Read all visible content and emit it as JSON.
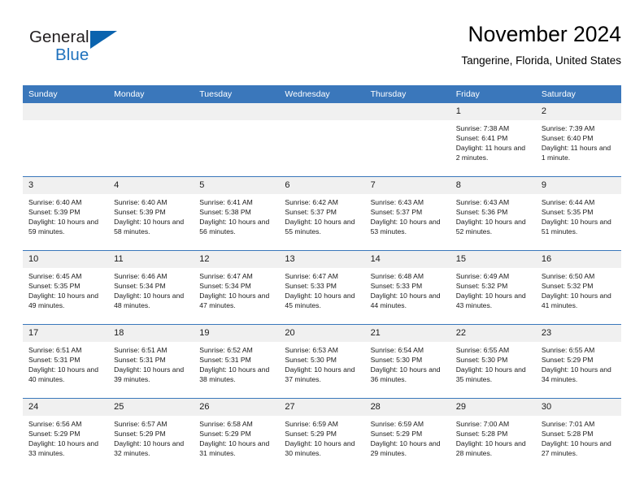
{
  "brand": {
    "name_top": "General",
    "name_bottom": "Blue",
    "color_dark": "#231f20",
    "color_blue": "#1f72bd",
    "triangle_color": "#0a63ae"
  },
  "header": {
    "title": "November 2024",
    "subtitle": "Tangerine, Florida, United States"
  },
  "theme": {
    "header_bar": "#3a77bb",
    "daynum_bg": "#f0f0f0",
    "cell_bg": "#ffffff",
    "text": "#1a1a1a"
  },
  "weekday_headers": [
    "Sunday",
    "Monday",
    "Tuesday",
    "Wednesday",
    "Thursday",
    "Friday",
    "Saturday"
  ],
  "labels": {
    "sunrise_prefix": "Sunrise:",
    "sunset_prefix": "Sunset:",
    "daylight_prefix": "Daylight:"
  },
  "weeks": [
    [
      {
        "day": "",
        "empty": true
      },
      {
        "day": "",
        "empty": true
      },
      {
        "day": "",
        "empty": true
      },
      {
        "day": "",
        "empty": true
      },
      {
        "day": "",
        "empty": true
      },
      {
        "day": "1",
        "sunrise": "Sunrise: 7:38 AM",
        "sunset": "Sunset: 6:41 PM",
        "daylight": "Daylight: 11 hours and 2 minutes."
      },
      {
        "day": "2",
        "sunrise": "Sunrise: 7:39 AM",
        "sunset": "Sunset: 6:40 PM",
        "daylight": "Daylight: 11 hours and 1 minute."
      }
    ],
    [
      {
        "day": "3",
        "sunrise": "Sunrise: 6:40 AM",
        "sunset": "Sunset: 5:39 PM",
        "daylight": "Daylight: 10 hours and 59 minutes."
      },
      {
        "day": "4",
        "sunrise": "Sunrise: 6:40 AM",
        "sunset": "Sunset: 5:39 PM",
        "daylight": "Daylight: 10 hours and 58 minutes."
      },
      {
        "day": "5",
        "sunrise": "Sunrise: 6:41 AM",
        "sunset": "Sunset: 5:38 PM",
        "daylight": "Daylight: 10 hours and 56 minutes."
      },
      {
        "day": "6",
        "sunrise": "Sunrise: 6:42 AM",
        "sunset": "Sunset: 5:37 PM",
        "daylight": "Daylight: 10 hours and 55 minutes."
      },
      {
        "day": "7",
        "sunrise": "Sunrise: 6:43 AM",
        "sunset": "Sunset: 5:37 PM",
        "daylight": "Daylight: 10 hours and 53 minutes."
      },
      {
        "day": "8",
        "sunrise": "Sunrise: 6:43 AM",
        "sunset": "Sunset: 5:36 PM",
        "daylight": "Daylight: 10 hours and 52 minutes."
      },
      {
        "day": "9",
        "sunrise": "Sunrise: 6:44 AM",
        "sunset": "Sunset: 5:35 PM",
        "daylight": "Daylight: 10 hours and 51 minutes."
      }
    ],
    [
      {
        "day": "10",
        "sunrise": "Sunrise: 6:45 AM",
        "sunset": "Sunset: 5:35 PM",
        "daylight": "Daylight: 10 hours and 49 minutes."
      },
      {
        "day": "11",
        "sunrise": "Sunrise: 6:46 AM",
        "sunset": "Sunset: 5:34 PM",
        "daylight": "Daylight: 10 hours and 48 minutes."
      },
      {
        "day": "12",
        "sunrise": "Sunrise: 6:47 AM",
        "sunset": "Sunset: 5:34 PM",
        "daylight": "Daylight: 10 hours and 47 minutes."
      },
      {
        "day": "13",
        "sunrise": "Sunrise: 6:47 AM",
        "sunset": "Sunset: 5:33 PM",
        "daylight": "Daylight: 10 hours and 45 minutes."
      },
      {
        "day": "14",
        "sunrise": "Sunrise: 6:48 AM",
        "sunset": "Sunset: 5:33 PM",
        "daylight": "Daylight: 10 hours and 44 minutes."
      },
      {
        "day": "15",
        "sunrise": "Sunrise: 6:49 AM",
        "sunset": "Sunset: 5:32 PM",
        "daylight": "Daylight: 10 hours and 43 minutes."
      },
      {
        "day": "16",
        "sunrise": "Sunrise: 6:50 AM",
        "sunset": "Sunset: 5:32 PM",
        "daylight": "Daylight: 10 hours and 41 minutes."
      }
    ],
    [
      {
        "day": "17",
        "sunrise": "Sunrise: 6:51 AM",
        "sunset": "Sunset: 5:31 PM",
        "daylight": "Daylight: 10 hours and 40 minutes."
      },
      {
        "day": "18",
        "sunrise": "Sunrise: 6:51 AM",
        "sunset": "Sunset: 5:31 PM",
        "daylight": "Daylight: 10 hours and 39 minutes."
      },
      {
        "day": "19",
        "sunrise": "Sunrise: 6:52 AM",
        "sunset": "Sunset: 5:31 PM",
        "daylight": "Daylight: 10 hours and 38 minutes."
      },
      {
        "day": "20",
        "sunrise": "Sunrise: 6:53 AM",
        "sunset": "Sunset: 5:30 PM",
        "daylight": "Daylight: 10 hours and 37 minutes."
      },
      {
        "day": "21",
        "sunrise": "Sunrise: 6:54 AM",
        "sunset": "Sunset: 5:30 PM",
        "daylight": "Daylight: 10 hours and 36 minutes."
      },
      {
        "day": "22",
        "sunrise": "Sunrise: 6:55 AM",
        "sunset": "Sunset: 5:30 PM",
        "daylight": "Daylight: 10 hours and 35 minutes."
      },
      {
        "day": "23",
        "sunrise": "Sunrise: 6:55 AM",
        "sunset": "Sunset: 5:29 PM",
        "daylight": "Daylight: 10 hours and 34 minutes."
      }
    ],
    [
      {
        "day": "24",
        "sunrise": "Sunrise: 6:56 AM",
        "sunset": "Sunset: 5:29 PM",
        "daylight": "Daylight: 10 hours and 33 minutes."
      },
      {
        "day": "25",
        "sunrise": "Sunrise: 6:57 AM",
        "sunset": "Sunset: 5:29 PM",
        "daylight": "Daylight: 10 hours and 32 minutes."
      },
      {
        "day": "26",
        "sunrise": "Sunrise: 6:58 AM",
        "sunset": "Sunset: 5:29 PM",
        "daylight": "Daylight: 10 hours and 31 minutes."
      },
      {
        "day": "27",
        "sunrise": "Sunrise: 6:59 AM",
        "sunset": "Sunset: 5:29 PM",
        "daylight": "Daylight: 10 hours and 30 minutes."
      },
      {
        "day": "28",
        "sunrise": "Sunrise: 6:59 AM",
        "sunset": "Sunset: 5:29 PM",
        "daylight": "Daylight: 10 hours and 29 minutes."
      },
      {
        "day": "29",
        "sunrise": "Sunrise: 7:00 AM",
        "sunset": "Sunset: 5:28 PM",
        "daylight": "Daylight: 10 hours and 28 minutes."
      },
      {
        "day": "30",
        "sunrise": "Sunrise: 7:01 AM",
        "sunset": "Sunset: 5:28 PM",
        "daylight": "Daylight: 10 hours and 27 minutes."
      }
    ]
  ]
}
